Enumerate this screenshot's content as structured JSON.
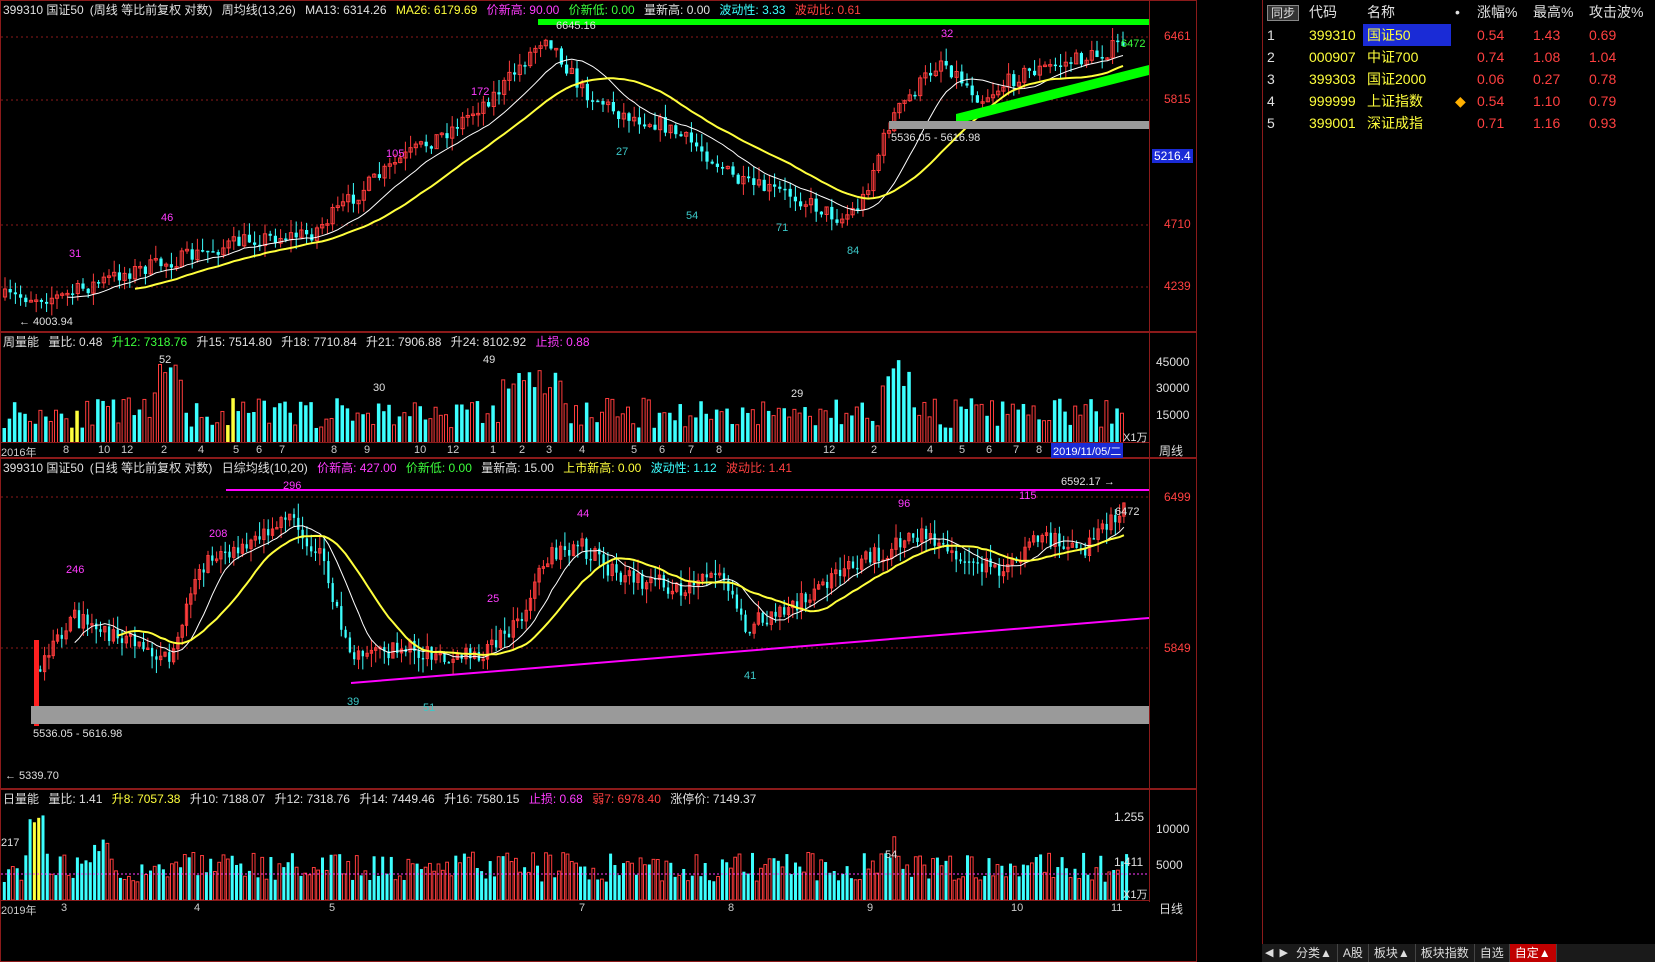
{
  "weekly_kline": {
    "code_name": "399310 国证50",
    "mode": "(周线 等比前复权 对数)",
    "indicator": "周均线(13,26)",
    "ma13_label": "MA13: 6314.26",
    "ma26_label": "MA26: 6179.69",
    "price_new_high": "价新高: 90.00",
    "price_new_low": "价新低: 0.00",
    "vol_new_high": "量新高: 0.00",
    "volatility": "波动性: 3.33",
    "vol_ratio": "波动比: 0.61",
    "y_ticks": [
      "6461",
      "5815",
      "4710",
      "4239"
    ],
    "current_price_tag": "5216.4",
    "low_label": "4003.94",
    "high_label": "6645.16",
    "band_label": "5536.05 - 5616.98",
    "cnt_labels": [
      "31",
      "46",
      "105",
      "172",
      "27",
      "54",
      "71",
      "84",
      "32"
    ],
    "right_label": "6472"
  },
  "weekly_vol": {
    "title": "周量能",
    "vol_ratio": "量比: 0.48",
    "up12": "升12: 7318.76",
    "up15": "升15: 7514.80",
    "up18": "升18: 7710.84",
    "up21": "升21: 7906.88",
    "up24": "升24: 8102.92",
    "stop": "止损: 0.88",
    "y_ticks": [
      "45000",
      "30000",
      "15000"
    ],
    "unit": "X1万",
    "peak_labels": [
      "52",
      "30",
      "49",
      "29"
    ],
    "x_labels": [
      "2016年",
      "8",
      "10",
      "12",
      "2",
      "4",
      "5",
      "6",
      "7",
      "8",
      "9",
      "10",
      "12",
      "1",
      "2",
      "3",
      "4",
      "5",
      "6",
      "7",
      "8",
      "12",
      "2",
      "4",
      "5",
      "6",
      "7",
      "8"
    ],
    "date_tag": "2019/11/05/二",
    "period_button": "周线"
  },
  "daily_kline": {
    "code_name": "399310 国证50",
    "mode": "(日线 等比前复权 对数)",
    "indicator": "日综均线(10,20)",
    "price_new_high": "价新高: 427.00",
    "price_new_low": "价新低: 0.00",
    "vol_new_high": "量新高: 15.00",
    "listing_new_high": "上市新高: 0.00",
    "volatility": "波动性: 1.12",
    "vol_ratio": "波动比: 1.41",
    "y_ticks": [
      "6499",
      "5849"
    ],
    "high_label": "6592.17",
    "low_label": "5339.70",
    "band_label": "5536.05 - 5616.98",
    "cnt_labels": [
      "246",
      "208",
      "296",
      "39",
      "51",
      "25",
      "44",
      "41",
      "96",
      "115"
    ],
    "right_label": "6472"
  },
  "daily_vol": {
    "title": "日量能",
    "vol_ratio": "量比: 1.41",
    "up8": "升8: 7057.38",
    "up10": "升10: 7188.07",
    "up12": "升12: 7318.76",
    "up14": "升14: 7449.46",
    "up16": "升16: 7580.15",
    "stop": "止损: 0.68",
    "weak7": "弱7: 6978.40",
    "limit_up": "涨停价: 7149.37",
    "y_ticks": [
      "10000",
      "5000"
    ],
    "unit": "X1万",
    "peak_labels": [
      "217",
      "54"
    ],
    "ratio_labels": [
      "1.255",
      "1.411"
    ],
    "x_labels": [
      "2019年",
      "3",
      "4",
      "5",
      "7",
      "8",
      "9",
      "10",
      "11"
    ],
    "period_button": "日线"
  },
  "watchlist": {
    "sync_button": "同步",
    "headers": [
      "代码",
      "名称",
      "•",
      "涨幅%",
      "最高%",
      "攻击波%"
    ],
    "rows": [
      {
        "idx": "1",
        "code": "399310",
        "name": "国证50",
        "flag": "",
        "chg": "0.54",
        "high": "1.43",
        "wave": "0.69"
      },
      {
        "idx": "2",
        "code": "000907",
        "name": "中证700",
        "flag": "",
        "chg": "0.74",
        "high": "1.08",
        "wave": "1.04"
      },
      {
        "idx": "3",
        "code": "399303",
        "name": "国证2000",
        "flag": "",
        "chg": "0.06",
        "high": "0.27",
        "wave": "0.78"
      },
      {
        "idx": "4",
        "code": "999999",
        "name": "上证指数",
        "flag": "◆",
        "chg": "0.54",
        "high": "1.10",
        "wave": "0.79"
      },
      {
        "idx": "5",
        "code": "399001",
        "name": "深证成指",
        "flag": "",
        "chg": "0.71",
        "high": "1.16",
        "wave": "0.93"
      }
    ]
  },
  "bottom_tabs": [
    "分类▲",
    "A股",
    "板块▲",
    "板块指数",
    "自选",
    "自定▲"
  ],
  "colors": {
    "up": "#ff3c3c",
    "down": "#3cffff",
    "ma_short": "#ffffff",
    "ma_long": "#ffff3c",
    "trend_green": "#00ff00",
    "trend_magenta": "#ff00ff",
    "band_gray": "#9a9a9a",
    "border": "#8b1a1a"
  }
}
